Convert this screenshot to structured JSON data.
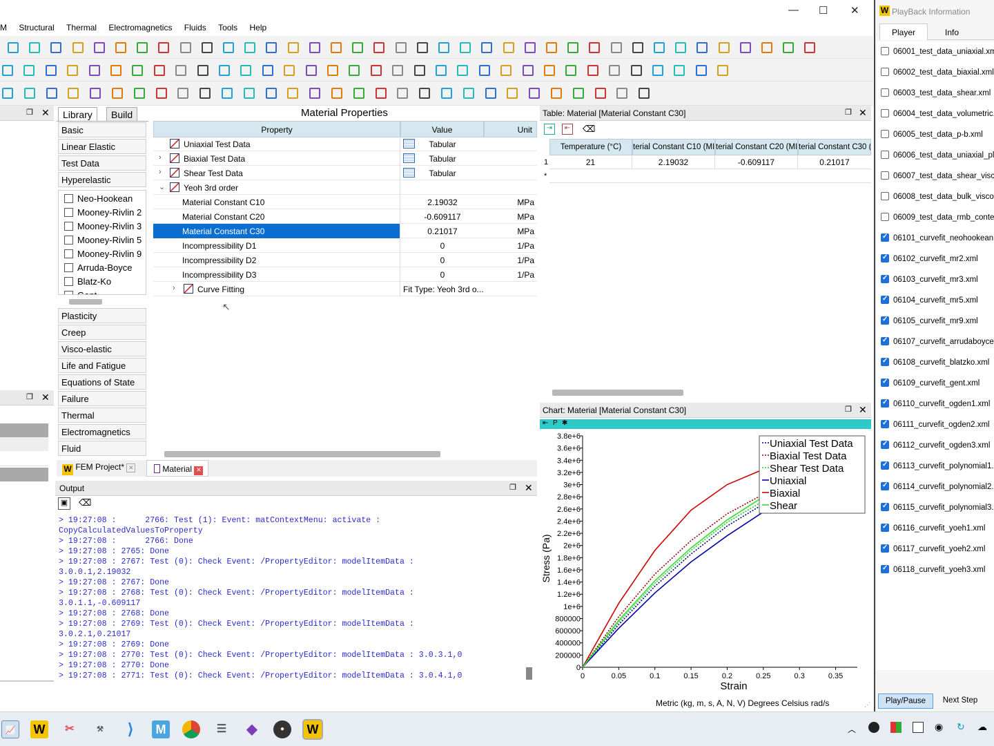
{
  "window": {
    "minimize": "—",
    "maximize": "☐",
    "close": "✕"
  },
  "menu": [
    "M",
    "Structural",
    "Thermal",
    "Electromagnetics",
    "Fluids",
    "Tools",
    "Help"
  ],
  "library": {
    "tabs": [
      "Library",
      "Build"
    ],
    "categories_top": [
      "Basic",
      "Linear Elastic",
      "Test Data",
      "Hyperelastic"
    ],
    "models": [
      "Neo-Hookean",
      "Mooney-Rivlin 2",
      "Mooney-Rivlin 3",
      "Mooney-Rivlin 5",
      "Mooney-Rivlin 9",
      "Arruda-Boyce",
      "Blatz-Ko",
      "Gent"
    ],
    "categories_bottom": [
      "Plasticity",
      "Creep",
      "Visco-elastic",
      "Life and Fatigue",
      "Equations of State",
      "Failure",
      "Thermal",
      "Electromagnetics",
      "Fluid"
    ]
  },
  "props": {
    "title": "Material Properties",
    "headers": {
      "property": "Property",
      "value": "Value",
      "unit": "Unit"
    },
    "rows": [
      {
        "name": "Uniaxial Test Data",
        "value": "Tabular",
        "unit": ""
      },
      {
        "name": "Biaxial Test Data",
        "value": "Tabular",
        "unit": ""
      },
      {
        "name": "Shear Test Data",
        "value": "Tabular",
        "unit": ""
      },
      {
        "name": "Yeoh 3rd order",
        "value": "",
        "unit": ""
      },
      {
        "name": "Material Constant C10",
        "value": "2.19032",
        "unit": "MPa"
      },
      {
        "name": "Material Constant C20",
        "value": "-0.609117",
        "unit": "MPa"
      },
      {
        "name": "Material Constant C30",
        "value": "0.21017",
        "unit": "MPa"
      },
      {
        "name": "Incompressibility D1",
        "value": "0",
        "unit": "1/Pa"
      },
      {
        "name": "Incompressibility D2",
        "value": "0",
        "unit": "1/Pa"
      },
      {
        "name": "Incompressibility D3",
        "value": "0",
        "unit": "1/Pa"
      },
      {
        "name": "Curve Fitting",
        "value": "Fit Type: Yeoh 3rd o...",
        "unit": ""
      }
    ]
  },
  "doc_tabs": [
    "FEM Project*",
    "Material"
  ],
  "output": {
    "title": "Output",
    "lines": [
      "> 19:27:08 :      2766: Test (1): Event: matContextMenu: activate :",
      "CopyCalculatedValuesToProperty",
      "> 19:27:08 :      2766: Done",
      "> 19:27:08 : 2765: Done",
      "> 19:27:08 : 2767: Test (0): Check Event: /PropertyEditor: modelItemData :",
      "3.0.0.1,2.19032",
      "> 19:27:08 : 2767: Done",
      "> 19:27:08 : 2768: Test (0): Check Event: /PropertyEditor: modelItemData :",
      "3.0.1.1,-0.609117",
      "> 19:27:08 : 2768: Done",
      "> 19:27:08 : 2769: Test (0): Check Event: /PropertyEditor: modelItemData :",
      "3.0.2.1,0.21017",
      "> 19:27:08 : 2769: Done",
      "> 19:27:08 : 2770: Test (0): Check Event: /PropertyEditor: modelItemData : 3.0.3.1,0",
      "> 19:27:08 : 2770: Done",
      "> 19:27:08 : 2771: Test (0): Check Event: /PropertyEditor: modelItemData : 3.0.4.1,0"
    ]
  },
  "table": {
    "title": "Table: Material [Material Constant C30]",
    "headers": [
      "Temperature (°C)",
      "terial Constant C10 (MI",
      "terial Constant C20 (MI",
      "terial Constant C30 ("
    ],
    "row_index": "1",
    "new_row_marker": "*",
    "row": [
      "21",
      "2.19032",
      "-0.609117",
      "0.21017"
    ]
  },
  "chart_panel": {
    "title": "Chart: Material [Material Constant C30]",
    "toolbar_label": "P"
  },
  "chart_data": {
    "type": "line",
    "xlabel": "Strain",
    "ylabel": "Stress (Pa)",
    "xlim": [
      0,
      0.38
    ],
    "ylim": [
      0,
      3800000
    ],
    "xticks": [
      "0",
      "0.05",
      "0.1",
      "0.15",
      "0.2",
      "0.25",
      "0.3",
      "0.35"
    ],
    "yticks": [
      "0",
      "200000",
      "400000",
      "600000",
      "800000",
      "1e+6",
      "1.2e+6",
      "1.4e+6",
      "1.6e+6",
      "1.8e+6",
      "2e+6",
      "2.2e+6",
      "2.4e+6",
      "2.6e+6",
      "2.8e+6",
      "3e+6",
      "3.2e+6",
      "3.4e+6",
      "3.6e+6",
      "3.8e+6"
    ],
    "legend_position": "top-right",
    "series": [
      {
        "name": "Uniaxial Test Data",
        "color": "#000080",
        "style": "dotted",
        "x": [
          0,
          0.05,
          0.1,
          0.15,
          0.2,
          0.25
        ],
        "y": [
          0,
          700000,
          1330000,
          1860000,
          2320000,
          2680000
        ]
      },
      {
        "name": "Biaxial Test Data",
        "color": "#8b0000",
        "style": "dotted",
        "x": [
          0,
          0.05,
          0.1,
          0.15,
          0.2,
          0.25
        ],
        "y": [
          0,
          830000,
          1530000,
          2080000,
          2520000,
          2840000
        ]
      },
      {
        "name": "Shear Test Data",
        "color": "#22cc22",
        "style": "dotted",
        "x": [
          0,
          0.05,
          0.1,
          0.15,
          0.2,
          0.25
        ],
        "y": [
          0,
          740000,
          1380000,
          1920000,
          2380000,
          2730000
        ]
      },
      {
        "name": "Uniaxial",
        "color": "#0000aa",
        "style": "solid",
        "x": [
          0,
          0.05,
          0.1,
          0.15,
          0.2,
          0.25
        ],
        "y": [
          0,
          640000,
          1220000,
          1730000,
          2160000,
          2550000
        ]
      },
      {
        "name": "Biaxial",
        "color": "#cc0000",
        "style": "solid",
        "x": [
          0,
          0.05,
          0.1,
          0.15,
          0.2,
          0.25
        ],
        "y": [
          0,
          1050000,
          1920000,
          2580000,
          3000000,
          3250000
        ]
      },
      {
        "name": "Shear",
        "color": "#33dd33",
        "style": "solid",
        "x": [
          0,
          0.05,
          0.1,
          0.15,
          0.2,
          0.25
        ],
        "y": [
          0,
          770000,
          1420000,
          1960000,
          2420000,
          2800000
        ]
      }
    ]
  },
  "status": "Metric (kg, m, s, A, N, V)  Degrees  Celsius  rad/s",
  "playback": {
    "title": "PlayBack Information",
    "tabs": [
      "Player",
      "Info"
    ],
    "items": [
      {
        "label": "06001_test_data_uniaxial.xm",
        "checked": false
      },
      {
        "label": "06002_test_data_biaxial.xml",
        "checked": false
      },
      {
        "label": "06003_test_data_shear.xml",
        "checked": false
      },
      {
        "label": "06004_test_data_volumetric.",
        "checked": false
      },
      {
        "label": "06005_test_data_p-b.xml",
        "checked": false
      },
      {
        "label": "06006_test_data_uniaxial_pla",
        "checked": false
      },
      {
        "label": "06007_test_data_shear_visco",
        "checked": false
      },
      {
        "label": "06008_test_data_bulk_viscoe",
        "checked": false
      },
      {
        "label": "06009_test_data_rmb_contex",
        "checked": false
      },
      {
        "label": "06101_curvefit_neohookean.",
        "checked": true
      },
      {
        "label": "06102_curvefit_mr2.xml",
        "checked": true
      },
      {
        "label": "06103_curvefit_mr3.xml",
        "checked": true
      },
      {
        "label": "06104_curvefit_mr5.xml",
        "checked": true
      },
      {
        "label": "06105_curvefit_mr9.xml",
        "checked": true
      },
      {
        "label": "06107_curvefit_arrudaboyce.",
        "checked": true
      },
      {
        "label": "06108_curvefit_blatzko.xml",
        "checked": true
      },
      {
        "label": "06109_curvefit_gent.xml",
        "checked": true
      },
      {
        "label": "06110_curvefit_ogden1.xml",
        "checked": true
      },
      {
        "label": "06111_curvefit_ogden2.xml",
        "checked": true
      },
      {
        "label": "06112_curvefit_ogden3.xml",
        "checked": true
      },
      {
        "label": "06113_curvefit_polynomial1.",
        "checked": true
      },
      {
        "label": "06114_curvefit_polynomial2.",
        "checked": true
      },
      {
        "label": "06115_curvefit_polynomial3.",
        "checked": true
      },
      {
        "label": "06116_curvefit_yoeh1.xml",
        "checked": true
      },
      {
        "label": "06117_curvefit_yoeh2.xml",
        "checked": true
      },
      {
        "label": "06118_curvefit_yoeh3.xml",
        "checked": true
      }
    ],
    "play_pause": "Play/Pause",
    "next_step": "Next Step"
  },
  "taskbar": {
    "app_letter": "W",
    "app_letter_m": "M"
  }
}
